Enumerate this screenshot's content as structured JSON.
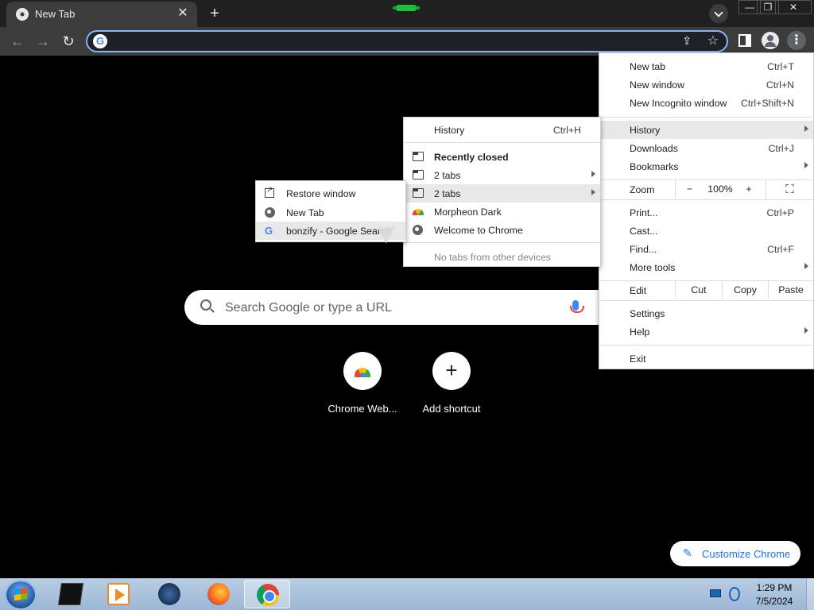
{
  "tab": {
    "title": "New Tab",
    "close": "✕"
  },
  "titlebar": {
    "new_tab": "+",
    "minimize": "—",
    "restore": "❐",
    "close": "✕"
  },
  "toolbar": {
    "back": "←",
    "forward": "→",
    "reload": "↻",
    "omnibox_g": "G",
    "share": "⇪",
    "star": "☆",
    "menu": "⋮"
  },
  "ntp": {
    "search_placeholder": "Search Google or type a URL",
    "shortcuts": [
      {
        "label": "Chrome Web..."
      },
      {
        "label": "Add shortcut"
      }
    ],
    "customize_label": "Customize Chrome",
    "customize_icon": "✎"
  },
  "main_menu": {
    "new_tab": {
      "label": "New tab",
      "shortcut": "Ctrl+T"
    },
    "new_window": {
      "label": "New window",
      "shortcut": "Ctrl+N"
    },
    "new_incognito": {
      "label": "New Incognito window",
      "shortcut": "Ctrl+Shift+N"
    },
    "history": {
      "label": "History"
    },
    "downloads": {
      "label": "Downloads",
      "shortcut": "Ctrl+J"
    },
    "bookmarks": {
      "label": "Bookmarks"
    },
    "zoom": {
      "label": "Zoom",
      "minus": "−",
      "value": "100%",
      "plus": "+",
      "fullscreen": "⛶"
    },
    "print": {
      "label": "Print...",
      "shortcut": "Ctrl+P"
    },
    "cast": {
      "label": "Cast..."
    },
    "find": {
      "label": "Find...",
      "shortcut": "Ctrl+F"
    },
    "more_tools": {
      "label": "More tools"
    },
    "edit": {
      "label": "Edit",
      "cut": "Cut",
      "copy": "Copy",
      "paste": "Paste"
    },
    "settings": {
      "label": "Settings"
    },
    "help": {
      "label": "Help"
    },
    "exit": {
      "label": "Exit"
    }
  },
  "history_menu": {
    "history": {
      "label": "History",
      "shortcut": "Ctrl+H"
    },
    "recently_closed": "Recently closed",
    "items": [
      "2 tabs",
      "2 tabs",
      "Morpheon Dark",
      "Welcome to Chrome"
    ],
    "no_tabs": "No tabs from other devices"
  },
  "tabs_submenu": {
    "items": [
      "Restore window",
      "New Tab",
      "bonzify - Google Search"
    ]
  },
  "taskbar": {
    "time": "1:29 PM",
    "date": "7/5/2024"
  },
  "colors": {
    "accent": "#8ab4f8",
    "toolbar": "#3c3c3c",
    "customize_text": "#1a73e8"
  }
}
